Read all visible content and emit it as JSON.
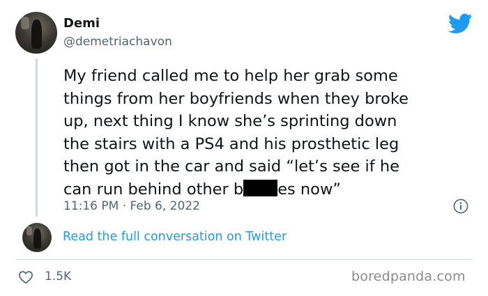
{
  "tweet": {
    "author_name": "Demi",
    "author_handle": "@demetriachavon",
    "text_lines": [
      "My friend called me to help her grab some",
      "things from her boyfriends when they broke",
      "up, next thing I know she’s sprinting down",
      "the stairs with a PS4 and his prosthetic leg",
      "then got in the car and said “let’s see if he"
    ],
    "last_line_start": "can run behind other b",
    "last_line_end": "es now”",
    "timestamp": "11:16 PM · Feb 6, 2022",
    "like_count": "1.5K"
  },
  "thread": {
    "read_more_label": "Read the full conversation on Twitter"
  },
  "icons": {
    "brand": "twitter-bird-icon",
    "info": "info-icon",
    "like": "heart-icon"
  },
  "colors": {
    "twitter_blue": "#1d9bf0",
    "secondary_text": "#536471",
    "primary_text": "#0f1419",
    "divider": "#cfd9de"
  },
  "watermark": "boredpanda.com"
}
